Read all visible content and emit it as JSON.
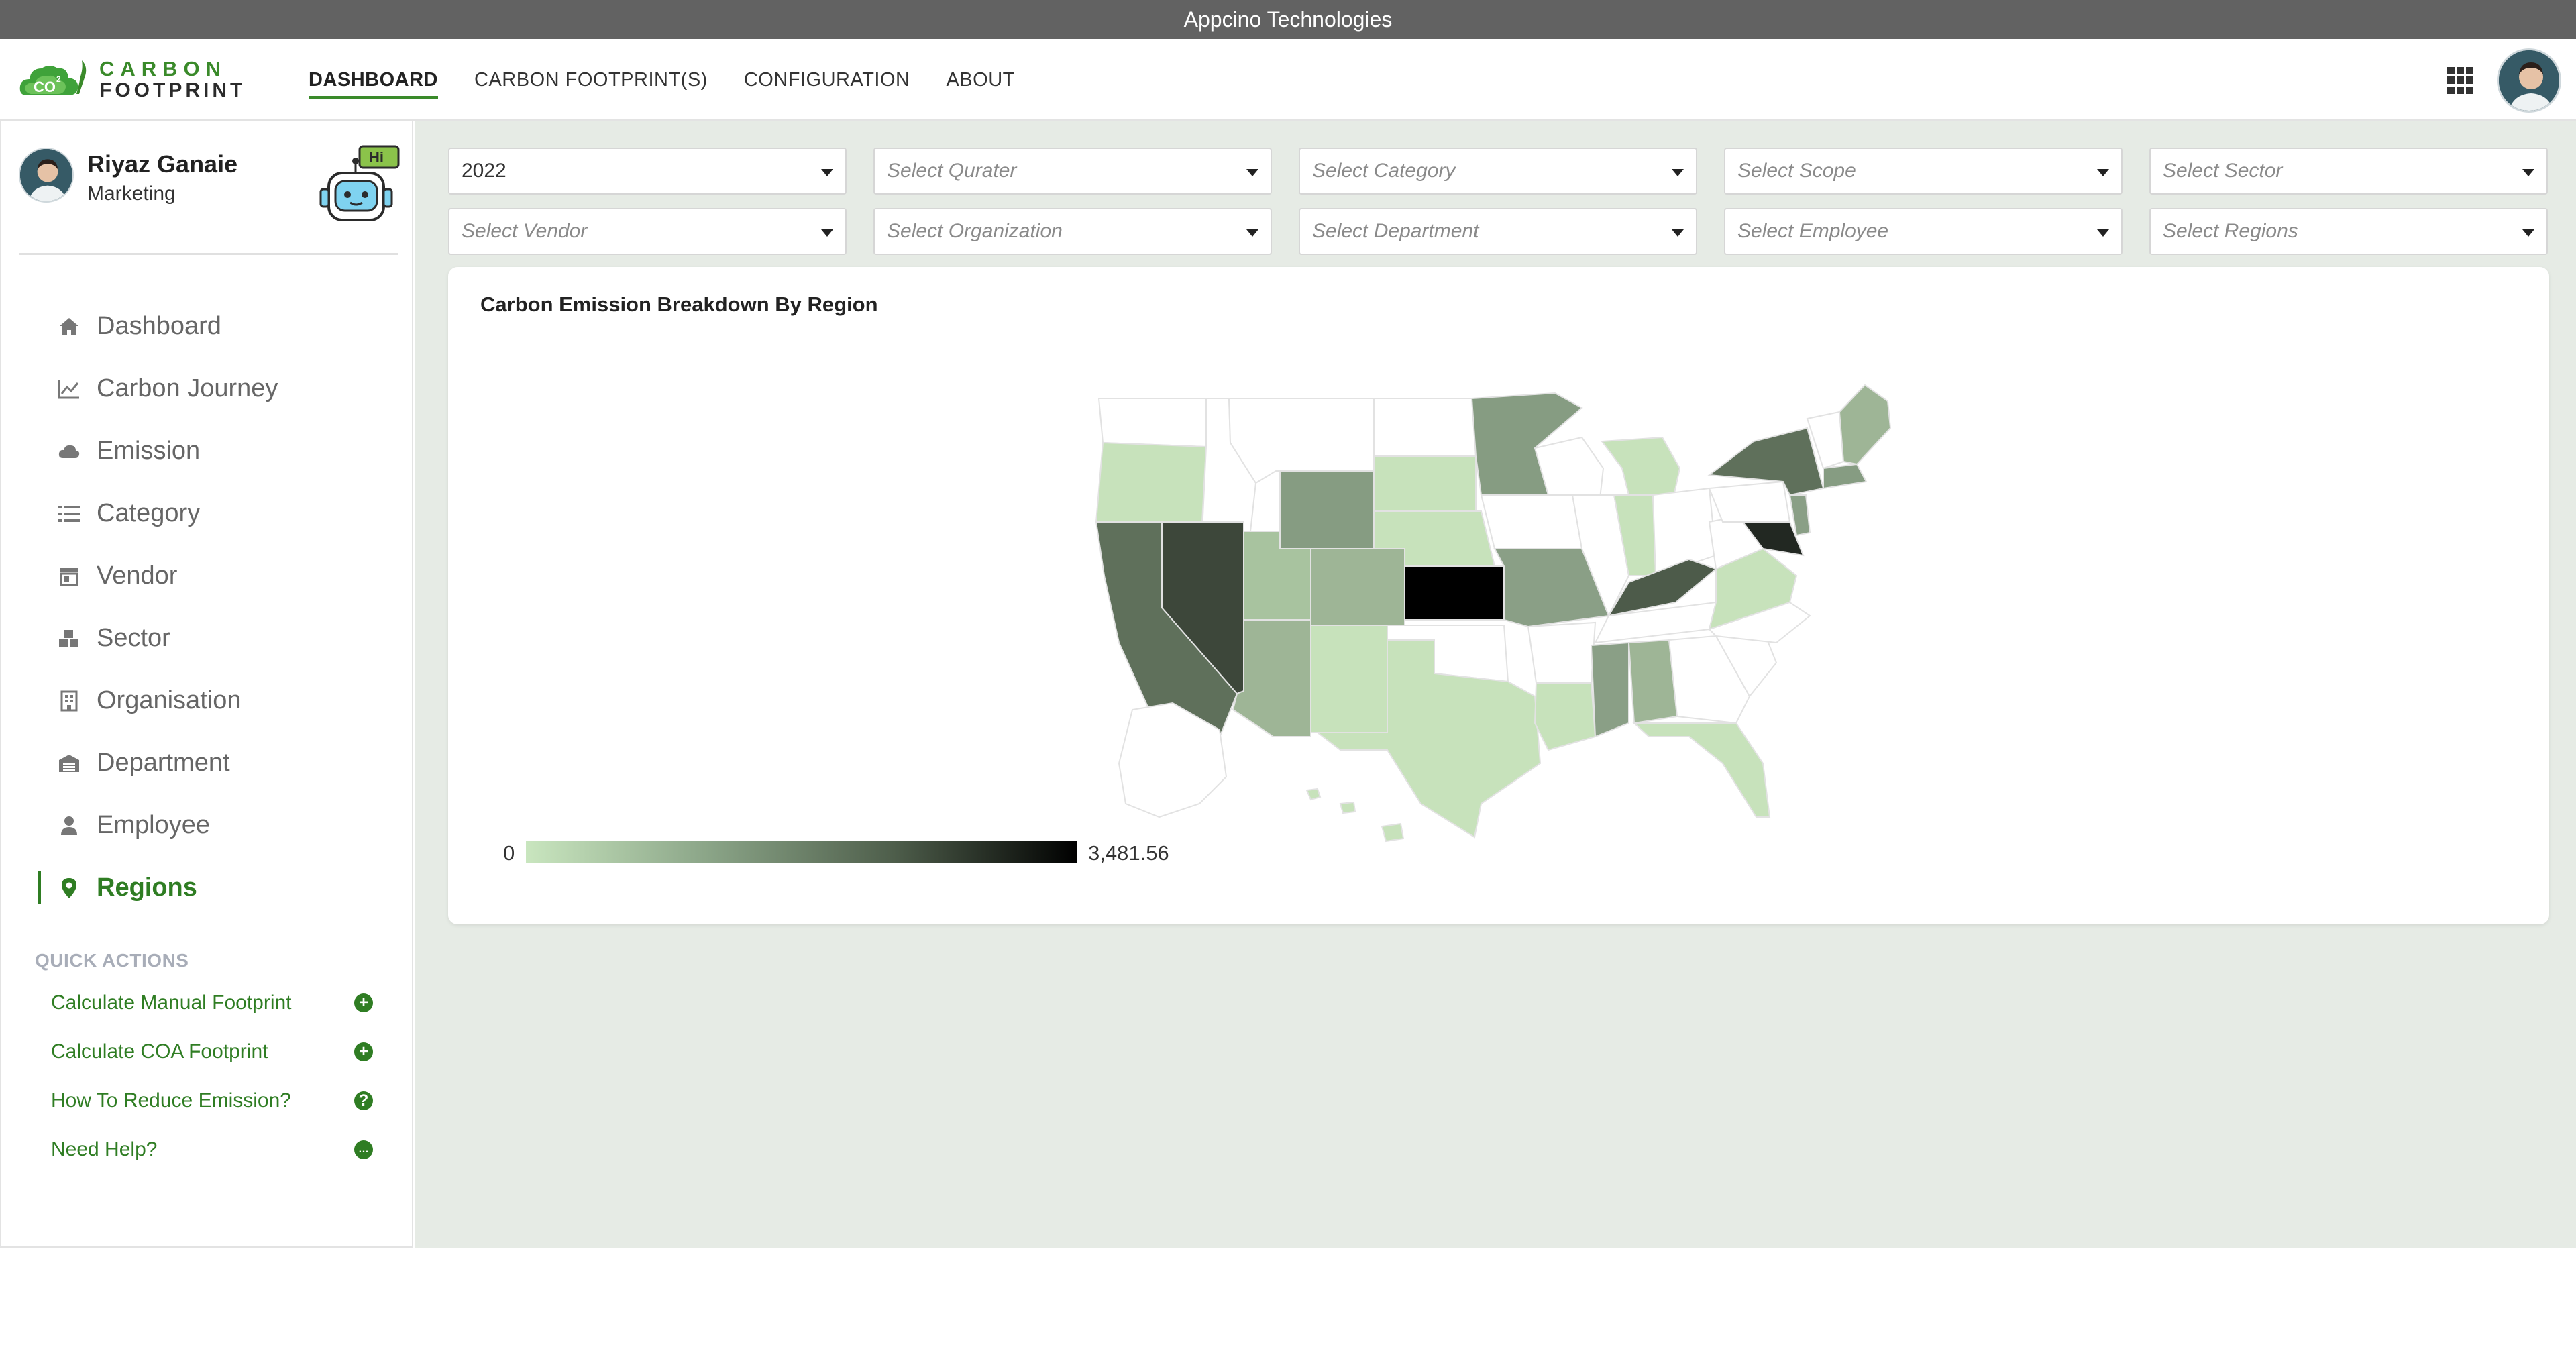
{
  "window": {
    "title": "Appcino Technologies"
  },
  "brand": {
    "line1": "CARBON",
    "line2": "FOOTPRINT",
    "cloud_text": "CO"
  },
  "nav": {
    "items": [
      {
        "label": "DASHBOARD",
        "active": true
      },
      {
        "label": "CARBON FOOTPRINT(S)",
        "active": false
      },
      {
        "label": "CONFIGURATION",
        "active": false
      },
      {
        "label": "ABOUT",
        "active": false
      }
    ]
  },
  "profile": {
    "name": "Riyaz Ganaie",
    "role": "Marketing",
    "bot_badge": "Hi"
  },
  "sidebar": {
    "items": [
      {
        "label": "Dashboard",
        "icon": "home-icon"
      },
      {
        "label": "Carbon Journey",
        "icon": "line-chart-icon"
      },
      {
        "label": "Emission",
        "icon": "cloud-icon"
      },
      {
        "label": "Category",
        "icon": "list-icon"
      },
      {
        "label": "Vendor",
        "icon": "store-icon"
      },
      {
        "label": "Sector",
        "icon": "boxes-icon"
      },
      {
        "label": "Organisation",
        "icon": "building-icon"
      },
      {
        "label": "Department",
        "icon": "warehouse-icon"
      },
      {
        "label": "Employee",
        "icon": "user-icon"
      },
      {
        "label": "Regions",
        "icon": "map-marker-icon",
        "active": true
      }
    ],
    "quick_actions_title": "QUICK ACTIONS",
    "quick_actions": [
      {
        "label": "Calculate Manual Footprint",
        "icon": "plus-circle-icon",
        "glyph": "+"
      },
      {
        "label": "Calculate COA Footprint",
        "icon": "plus-circle-icon",
        "glyph": "+"
      },
      {
        "label": "How To Reduce Emission?",
        "icon": "question-circle-icon",
        "glyph": "?"
      },
      {
        "label": "Need Help?",
        "icon": "comment-icon",
        "glyph": "…"
      }
    ]
  },
  "filters": {
    "year": {
      "value": "2022"
    },
    "quarter": {
      "placeholder": "Select Qurater"
    },
    "category": {
      "placeholder": "Select Category"
    },
    "scope": {
      "placeholder": "Select Scope"
    },
    "sector": {
      "placeholder": "Select Sector"
    },
    "vendor": {
      "placeholder": "Select Vendor"
    },
    "organization": {
      "placeholder": "Select Organization"
    },
    "department": {
      "placeholder": "Select Department"
    },
    "employee": {
      "placeholder": "Select Employee"
    },
    "regions": {
      "placeholder": "Select Regions"
    }
  },
  "chart_data": {
    "type": "heatmap",
    "title": "Carbon Emission Breakdown By Region",
    "legend": {
      "min_label": "0",
      "max_label": "3,481.56",
      "min": 0,
      "max": 3481.56,
      "colors": [
        "#c9e6bf",
        "#000000"
      ]
    }
  }
}
